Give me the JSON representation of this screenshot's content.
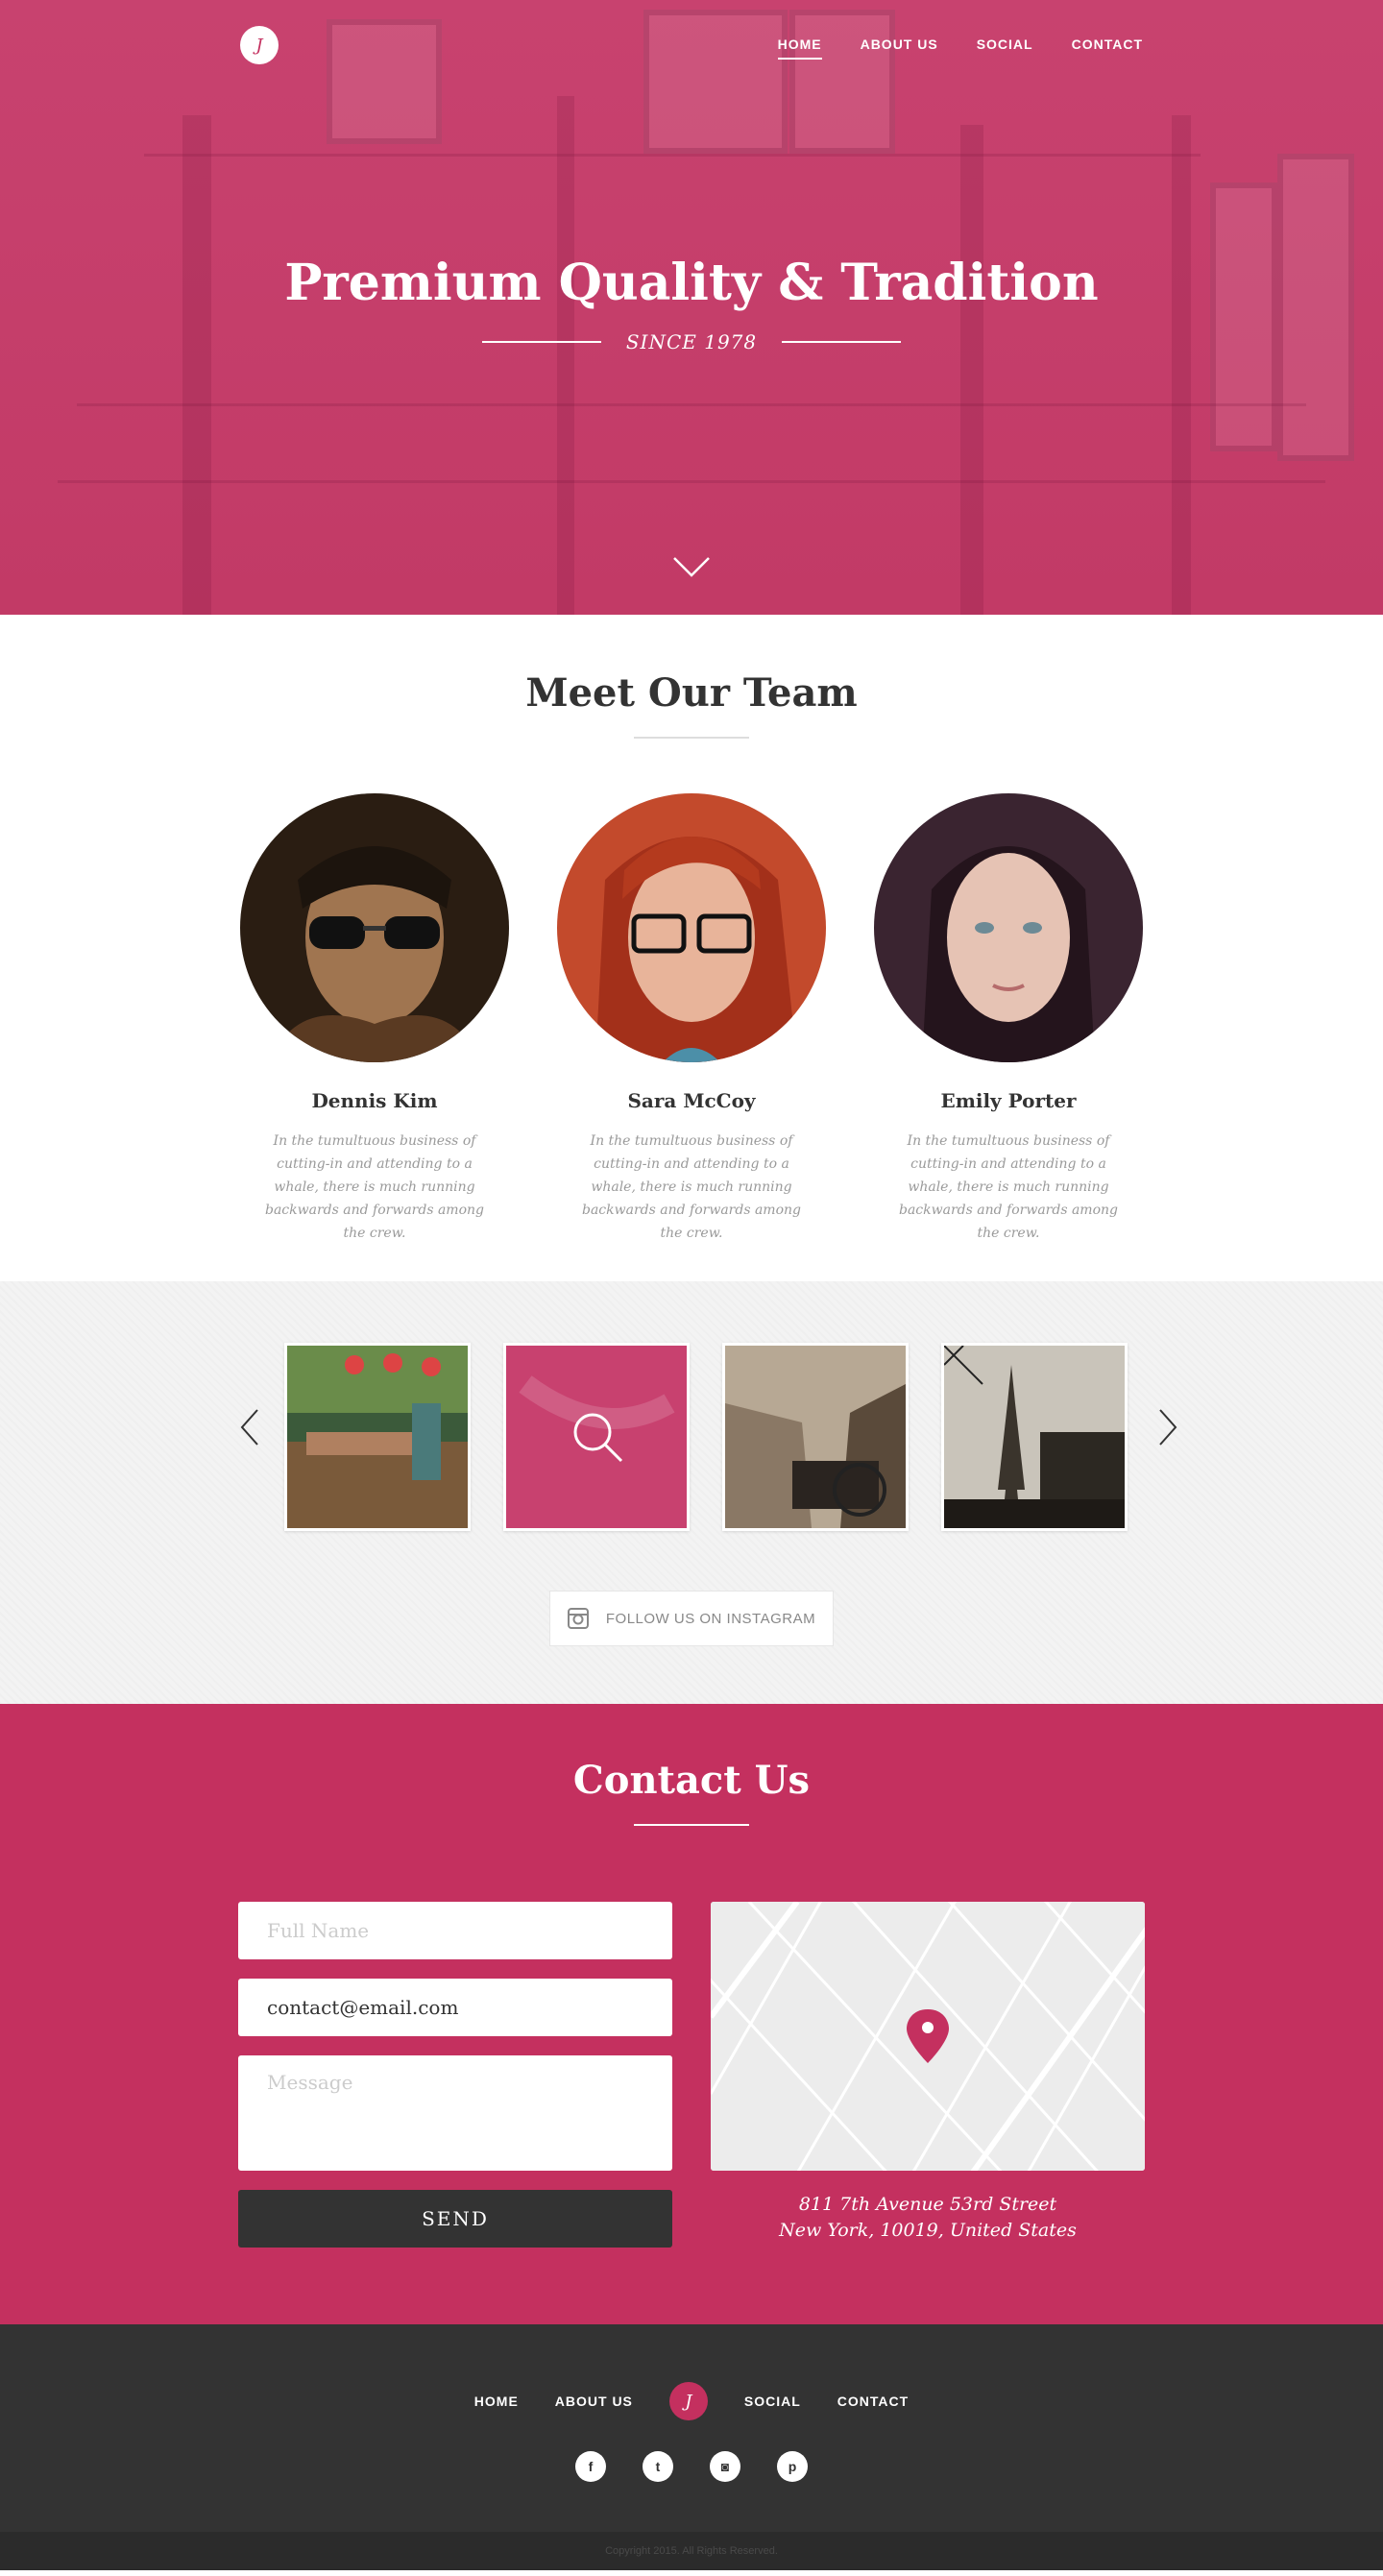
{
  "colors": {
    "accent": "#c4305f",
    "dark": "#333333",
    "light_bg": "#f3f3f3"
  },
  "nav": {
    "logo_letter": "J",
    "items": [
      {
        "label": "HOME",
        "active": true
      },
      {
        "label": "ABOUT US"
      },
      {
        "label": "SOCIAL"
      },
      {
        "label": "CONTACT"
      }
    ]
  },
  "hero": {
    "title": "Premium Quality & Tradition",
    "subtitle": "SINCE 1978",
    "scroll_icon": "chevron-down-icon"
  },
  "team": {
    "title": "Meet Our Team",
    "members": [
      {
        "name": "Dennis Kim",
        "bio": "In the tumultuous business of cutting-in and attending to a whale, there is much running backwards and forwards among the crew."
      },
      {
        "name": "Sara McCoy",
        "bio": "In the tumultuous business of cutting-in and attending to a whale, there is much running backwards and forwards among the crew."
      },
      {
        "name": "Emily Porter",
        "bio": "In the tumultuous business of cutting-in and attending to a whale, there is much running backwards and forwards among the crew."
      }
    ]
  },
  "gallery": {
    "thumbs": [
      "cafe-table",
      "search-overlay",
      "bicycle-street",
      "eiffel-tower"
    ],
    "instagram_label": "FOLLOW US ON INSTAGRAM"
  },
  "contact": {
    "title": "Contact Us",
    "name_placeholder": "Full Name",
    "email_value": "contact@email.com",
    "message_placeholder": "Message",
    "send_label": "SEND",
    "address_line1": "811 7th Avenue 53rd Street",
    "address_line2": "New York, 10019, United States"
  },
  "footer": {
    "nav_left": [
      "HOME",
      "ABOUT US"
    ],
    "nav_right": [
      "SOCIAL",
      "CONTACT"
    ],
    "logo_letter": "J",
    "socials": [
      {
        "icon": "facebook-icon",
        "glyph": "f"
      },
      {
        "icon": "twitter-icon",
        "glyph": "t"
      },
      {
        "icon": "instagram-icon",
        "glyph": "◙"
      },
      {
        "icon": "pinterest-icon",
        "glyph": "p"
      }
    ],
    "copyright": "Copyright 2015. All Rights Reserved."
  }
}
